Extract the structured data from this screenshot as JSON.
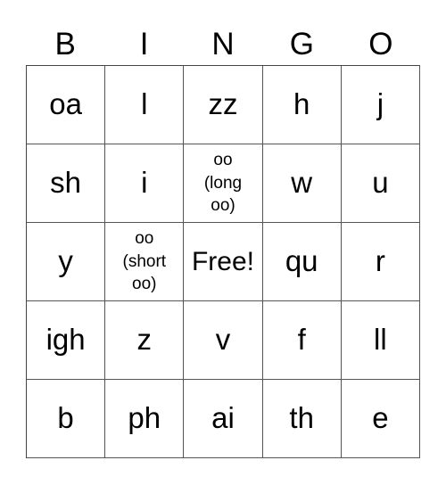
{
  "header": [
    "B",
    "I",
    "N",
    "G",
    "O"
  ],
  "rows": [
    [
      {
        "text": "oa"
      },
      {
        "text": "l"
      },
      {
        "text": "zz"
      },
      {
        "text": "h"
      },
      {
        "text": "j"
      }
    ],
    [
      {
        "text": "sh"
      },
      {
        "text": "i"
      },
      {
        "text": "oo (long oo)",
        "small": true
      },
      {
        "text": "w"
      },
      {
        "text": "u"
      }
    ],
    [
      {
        "text": "y"
      },
      {
        "text": "oo (short oo)",
        "small": true
      },
      {
        "text": "Free!",
        "free": true
      },
      {
        "text": "qu"
      },
      {
        "text": "r"
      }
    ],
    [
      {
        "text": "igh"
      },
      {
        "text": "z"
      },
      {
        "text": "v"
      },
      {
        "text": "f"
      },
      {
        "text": "ll"
      }
    ],
    [
      {
        "text": "b"
      },
      {
        "text": "ph"
      },
      {
        "text": "ai"
      },
      {
        "text": "th"
      },
      {
        "text": "e"
      }
    ]
  ]
}
